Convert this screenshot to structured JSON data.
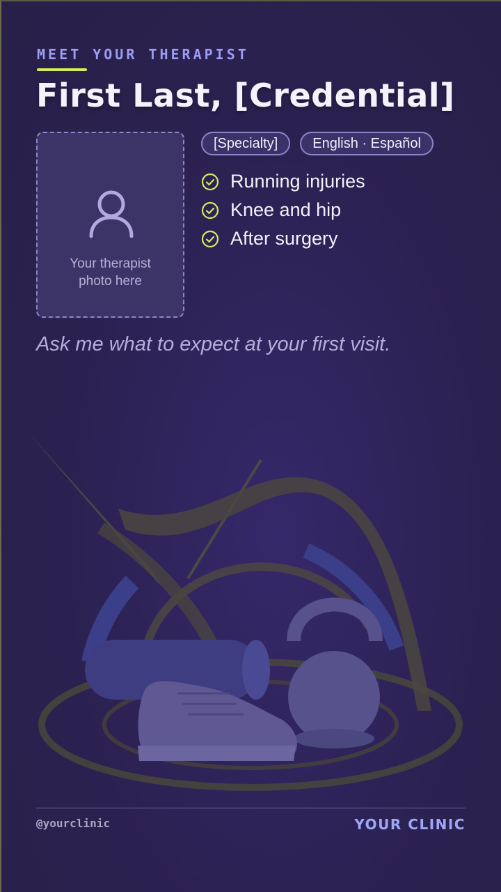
{
  "header": {
    "eyebrow": "MEET YOUR THERAPIST",
    "title": "First Last, [Credential]"
  },
  "photo": {
    "icon": "user-icon",
    "caption_line1": "Your therapist",
    "caption_line2": "photo here"
  },
  "chips": [
    {
      "label": "[Specialty]"
    },
    {
      "label": "English · Español"
    }
  ],
  "focus_areas": [
    {
      "icon": "check-circle-icon",
      "label": "Running injuries"
    },
    {
      "icon": "check-circle-icon",
      "label": "Knee and hip"
    },
    {
      "icon": "check-circle-icon",
      "label": "After surgery"
    }
  ],
  "tagline": "Ask me what to expect at your first visit.",
  "footer": {
    "handle": "@yourclinic",
    "clinic": "YOUR CLINIC"
  },
  "colors": {
    "background": "#2b2150",
    "accent_lime": "#d4ec5c",
    "accent_lavender": "#9c9cf4"
  }
}
